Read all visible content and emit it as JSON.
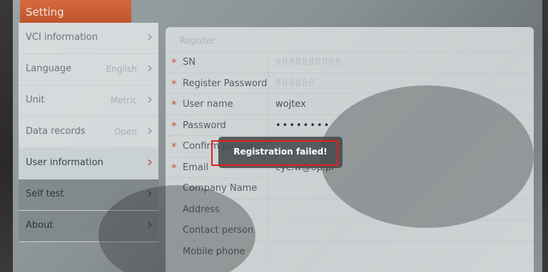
{
  "title": "Setting",
  "sidebar": {
    "items": [
      {
        "label": "VCI information",
        "value": ""
      },
      {
        "label": "Language",
        "value": "English"
      },
      {
        "label": "Unit",
        "value": "Metric"
      },
      {
        "label": "Data records",
        "value": "Open"
      },
      {
        "label": "User information",
        "value": ""
      },
      {
        "label": "Self test",
        "value": ""
      },
      {
        "label": "About",
        "value": ""
      }
    ]
  },
  "form": {
    "header": "Register",
    "rows": [
      {
        "label": "SN",
        "value": "9888888888",
        "required": true
      },
      {
        "label": "Register Password",
        "value": "888888",
        "required": true
      },
      {
        "label": "User name",
        "value": "wojtex",
        "required": true
      },
      {
        "label": "Password",
        "value": "••••••••",
        "required": true
      },
      {
        "label": "Confirm password",
        "value": "",
        "required": true
      },
      {
        "label": "Email",
        "value": "cyc.w@op.pl",
        "required": true
      },
      {
        "label": "Company Name",
        "value": "",
        "required": false
      },
      {
        "label": "Address",
        "value": "",
        "required": false
      },
      {
        "label": "Contact person",
        "value": "",
        "required": false
      },
      {
        "label": "Mobile phone",
        "value": "",
        "required": false
      }
    ]
  },
  "toast": {
    "message": "Registration failed!"
  },
  "colors": {
    "accent": "#c0552d",
    "highlight": "#e0231f"
  }
}
